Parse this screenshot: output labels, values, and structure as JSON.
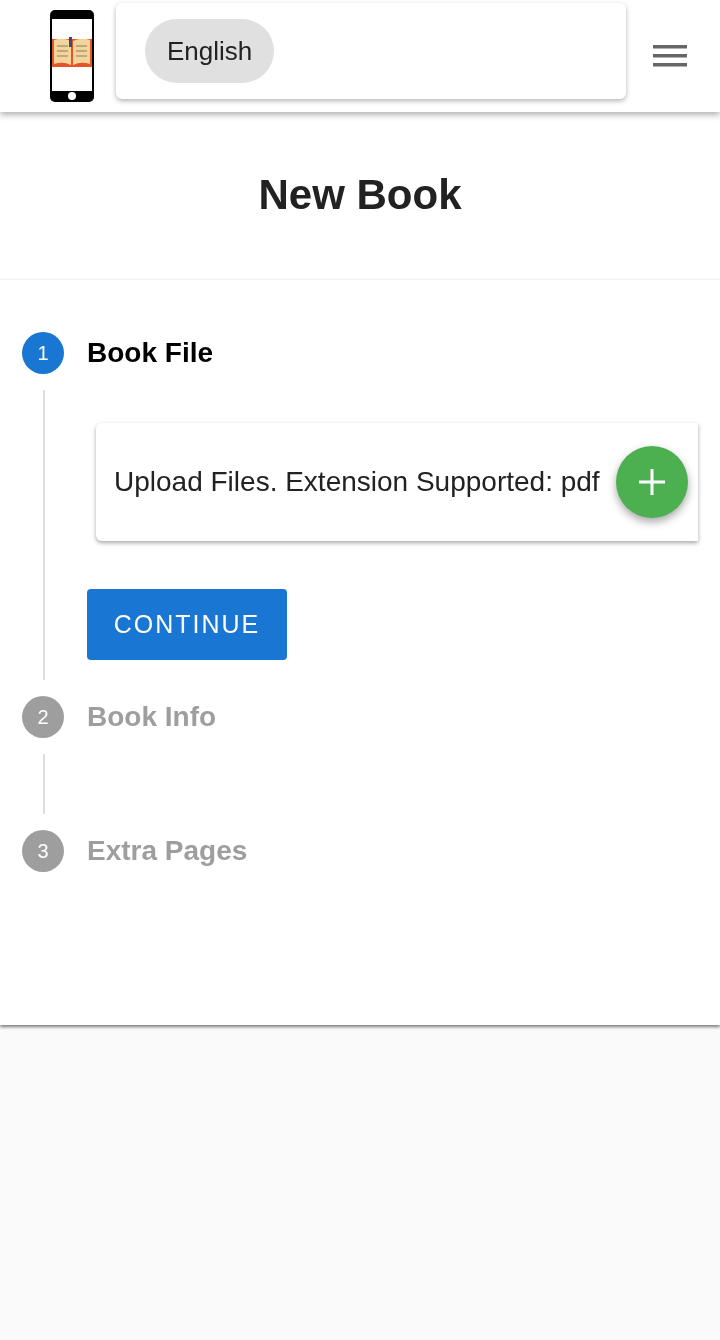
{
  "header": {
    "language": "English"
  },
  "title": "New Book",
  "steps": [
    {
      "number": "1",
      "label": "Book File",
      "selected": true,
      "upload": {
        "text": "Upload Files. Extension Supported: pdf"
      },
      "button": "CONTINUE"
    },
    {
      "number": "2",
      "label": "Book Info",
      "selected": false
    },
    {
      "number": "3",
      "label": "Extra Pages",
      "selected": false
    }
  ]
}
